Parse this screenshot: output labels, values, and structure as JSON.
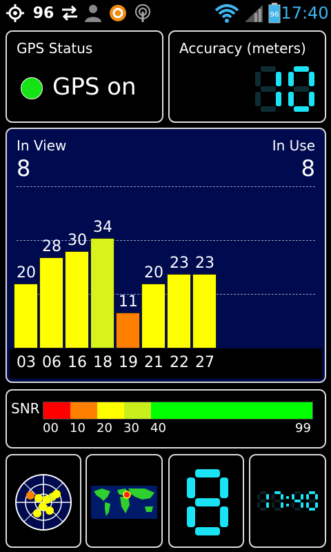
{
  "status_bar": {
    "battery_level_text": "96",
    "battery_badge": "96",
    "clock": "17:40",
    "icons": [
      "gps-target-icon",
      "sync-arrows-icon",
      "person-icon",
      "app-orange-icon",
      "antenna-icon",
      "wifi-icon",
      "cell-signal-icon",
      "battery-icon"
    ]
  },
  "gps_status": {
    "title": "GPS Status",
    "value": "GPS on",
    "indicator_color": "#16e316"
  },
  "accuracy": {
    "title": "Accuracy (meters)",
    "value": "10",
    "digit_color": "#19e3f4"
  },
  "satellites": {
    "in_view_label": "In View",
    "in_view_count": "8",
    "in_use_label": "In Use",
    "in_use_count": "8",
    "background_color": "#000a4f"
  },
  "chart_data": {
    "type": "bar",
    "categories": [
      "03",
      "06",
      "16",
      "18",
      "19",
      "21",
      "22",
      "27"
    ],
    "values": [
      20,
      28,
      30,
      34,
      11,
      20,
      23,
      23
    ],
    "colors": [
      "#ffff00",
      "#ffff00",
      "#ffff00",
      "#d7f31b",
      "#ff8000",
      "#ffff00",
      "#ffff00",
      "#ffff00"
    ],
    "ylim": [
      0,
      50
    ],
    "grid": "dashed horizontal"
  },
  "snr": {
    "label": "SNR",
    "ticks": [
      "00",
      "10",
      "20",
      "30",
      "40",
      "99"
    ],
    "scale_colors": [
      "#ff0000",
      "#ff8000",
      "#ffff00",
      "#c8ee1c",
      "#00ff00"
    ]
  },
  "bottom_tiles": {
    "radar_icon": "satellite-radar-icon",
    "world_map_icon": "world-map-icon",
    "big_digit": "8",
    "clock_digits": "17:40"
  }
}
